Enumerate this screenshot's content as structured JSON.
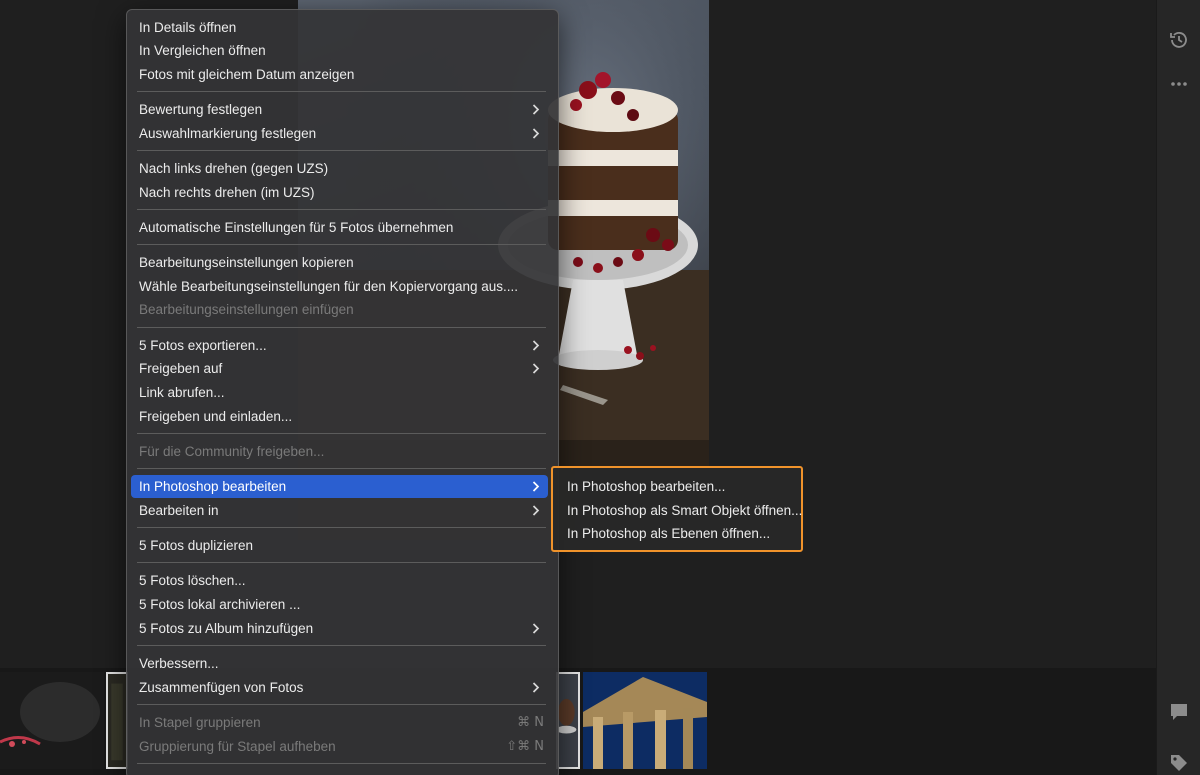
{
  "context_menu": {
    "items": [
      {
        "label": "In Details öffnen"
      },
      {
        "label": "In Vergleichen öffnen"
      },
      {
        "label": "Fotos mit gleichem Datum anzeigen"
      },
      {
        "label": "Bewertung festlegen"
      },
      {
        "label": "Auswahlmarkierung festlegen"
      },
      {
        "label": "Nach links drehen (gegen UZS)"
      },
      {
        "label": "Nach rechts drehen (im UZS)"
      },
      {
        "label": "Automatische Einstellungen für 5 Fotos übernehmen"
      },
      {
        "label": "Bearbeitungseinstellungen kopieren"
      },
      {
        "label": "Wähle Bearbeitungseinstellungen für den Kopiervorgang aus...."
      },
      {
        "label": "Bearbeitungseinstellungen einfügen"
      },
      {
        "label": "5 Fotos exportieren..."
      },
      {
        "label": "Freigeben auf"
      },
      {
        "label": "Link abrufen..."
      },
      {
        "label": "Freigeben und einladen..."
      },
      {
        "label": "Für die Community freigeben..."
      },
      {
        "label": "In Photoshop bearbeiten"
      },
      {
        "label": "Bearbeiten in"
      },
      {
        "label": "5 Fotos duplizieren"
      },
      {
        "label": "5 Fotos löschen..."
      },
      {
        "label": "5 Fotos lokal archivieren ..."
      },
      {
        "label": "5 Fotos zu Album hinzufügen"
      },
      {
        "label": "Verbessern..."
      },
      {
        "label": "Zusammenfügen von Fotos"
      },
      {
        "label": "In Stapel gruppieren",
        "shortcut": "⌘ N"
      },
      {
        "label": "Gruppierung für Stapel aufheben",
        "shortcut": "⇧⌘ N"
      }
    ]
  },
  "submenu": {
    "items": [
      {
        "label": "In Photoshop bearbeiten..."
      },
      {
        "label": "In Photoshop als Smart Objekt öffnen..."
      },
      {
        "label": "In Photoshop als Ebenen öffnen..."
      }
    ],
    "highlight_color": "#f0932b"
  },
  "right_panel": {
    "icons": [
      "history-icon",
      "more-icon",
      "comment-icon",
      "tag-icon"
    ]
  },
  "colors": {
    "menu_highlight": "#2b5fd0",
    "background": "#1e1e1e"
  }
}
